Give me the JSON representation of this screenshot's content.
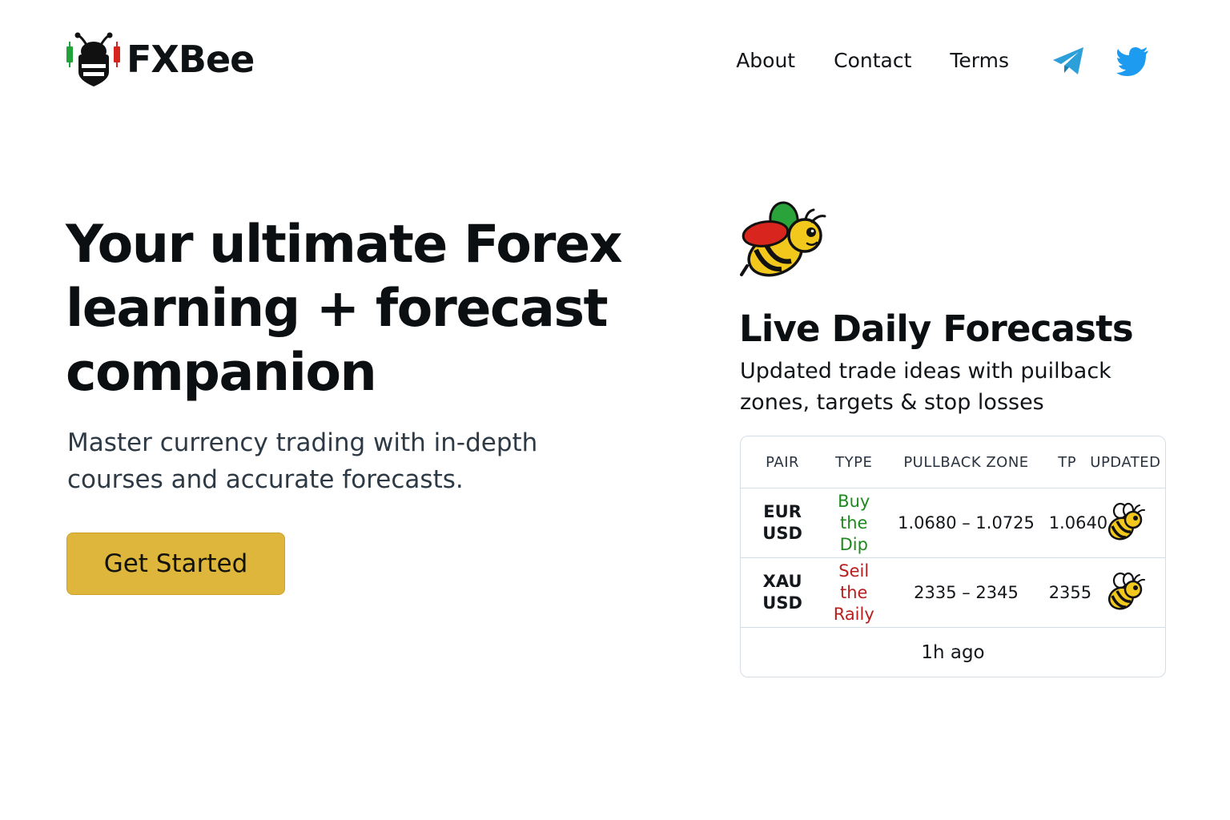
{
  "brand": {
    "name": "FXBee",
    "logo_icon": "bee-candlestick-logo-icon",
    "candle_up_color": "#21a33a",
    "candle_down_color": "#d6251f"
  },
  "nav": {
    "links": [
      {
        "label": "About"
      },
      {
        "label": "Contact"
      },
      {
        "label": "Terms"
      }
    ],
    "social": [
      {
        "icon": "telegram-icon",
        "color": "#2d9fd9"
      },
      {
        "icon": "twitter-icon",
        "color": "#1d9bf0"
      }
    ]
  },
  "hero": {
    "title": "Your ultimate Forex learning + forecast companion",
    "subtitle": "Master currency trading with in-depth courses and accurate forecasts.",
    "cta_label": "Get Started",
    "cta_color": "#ddb63b"
  },
  "forecast": {
    "mascot_icon": "bee-mascot-icon",
    "title": "Live Daily Forecasts",
    "subtitle": "Updated trade ideas with puilback zones, targets & stop losses",
    "columns": [
      "PAIR",
      "TYPE",
      "PULLBACK ZONE",
      "TP",
      "UPDATED"
    ],
    "rows": [
      {
        "pair_top": "EUR",
        "pair_bottom": "USD",
        "type_top": "Buy the",
        "type_bottom": "Dip",
        "type_color": "#1d8a1d",
        "zone": "1.0680 – 1.0725",
        "tp": "1.0640",
        "updated_icon": "bee-icon"
      },
      {
        "pair_top": "XAU",
        "pair_bottom": "USD",
        "type_top": "Seil the",
        "type_bottom": "Raily",
        "type_color": "#b81e1e",
        "zone": "2335 –  2345",
        "tp": "2355",
        "updated_icon": "bee-icon"
      }
    ],
    "footer": "1h ago"
  }
}
